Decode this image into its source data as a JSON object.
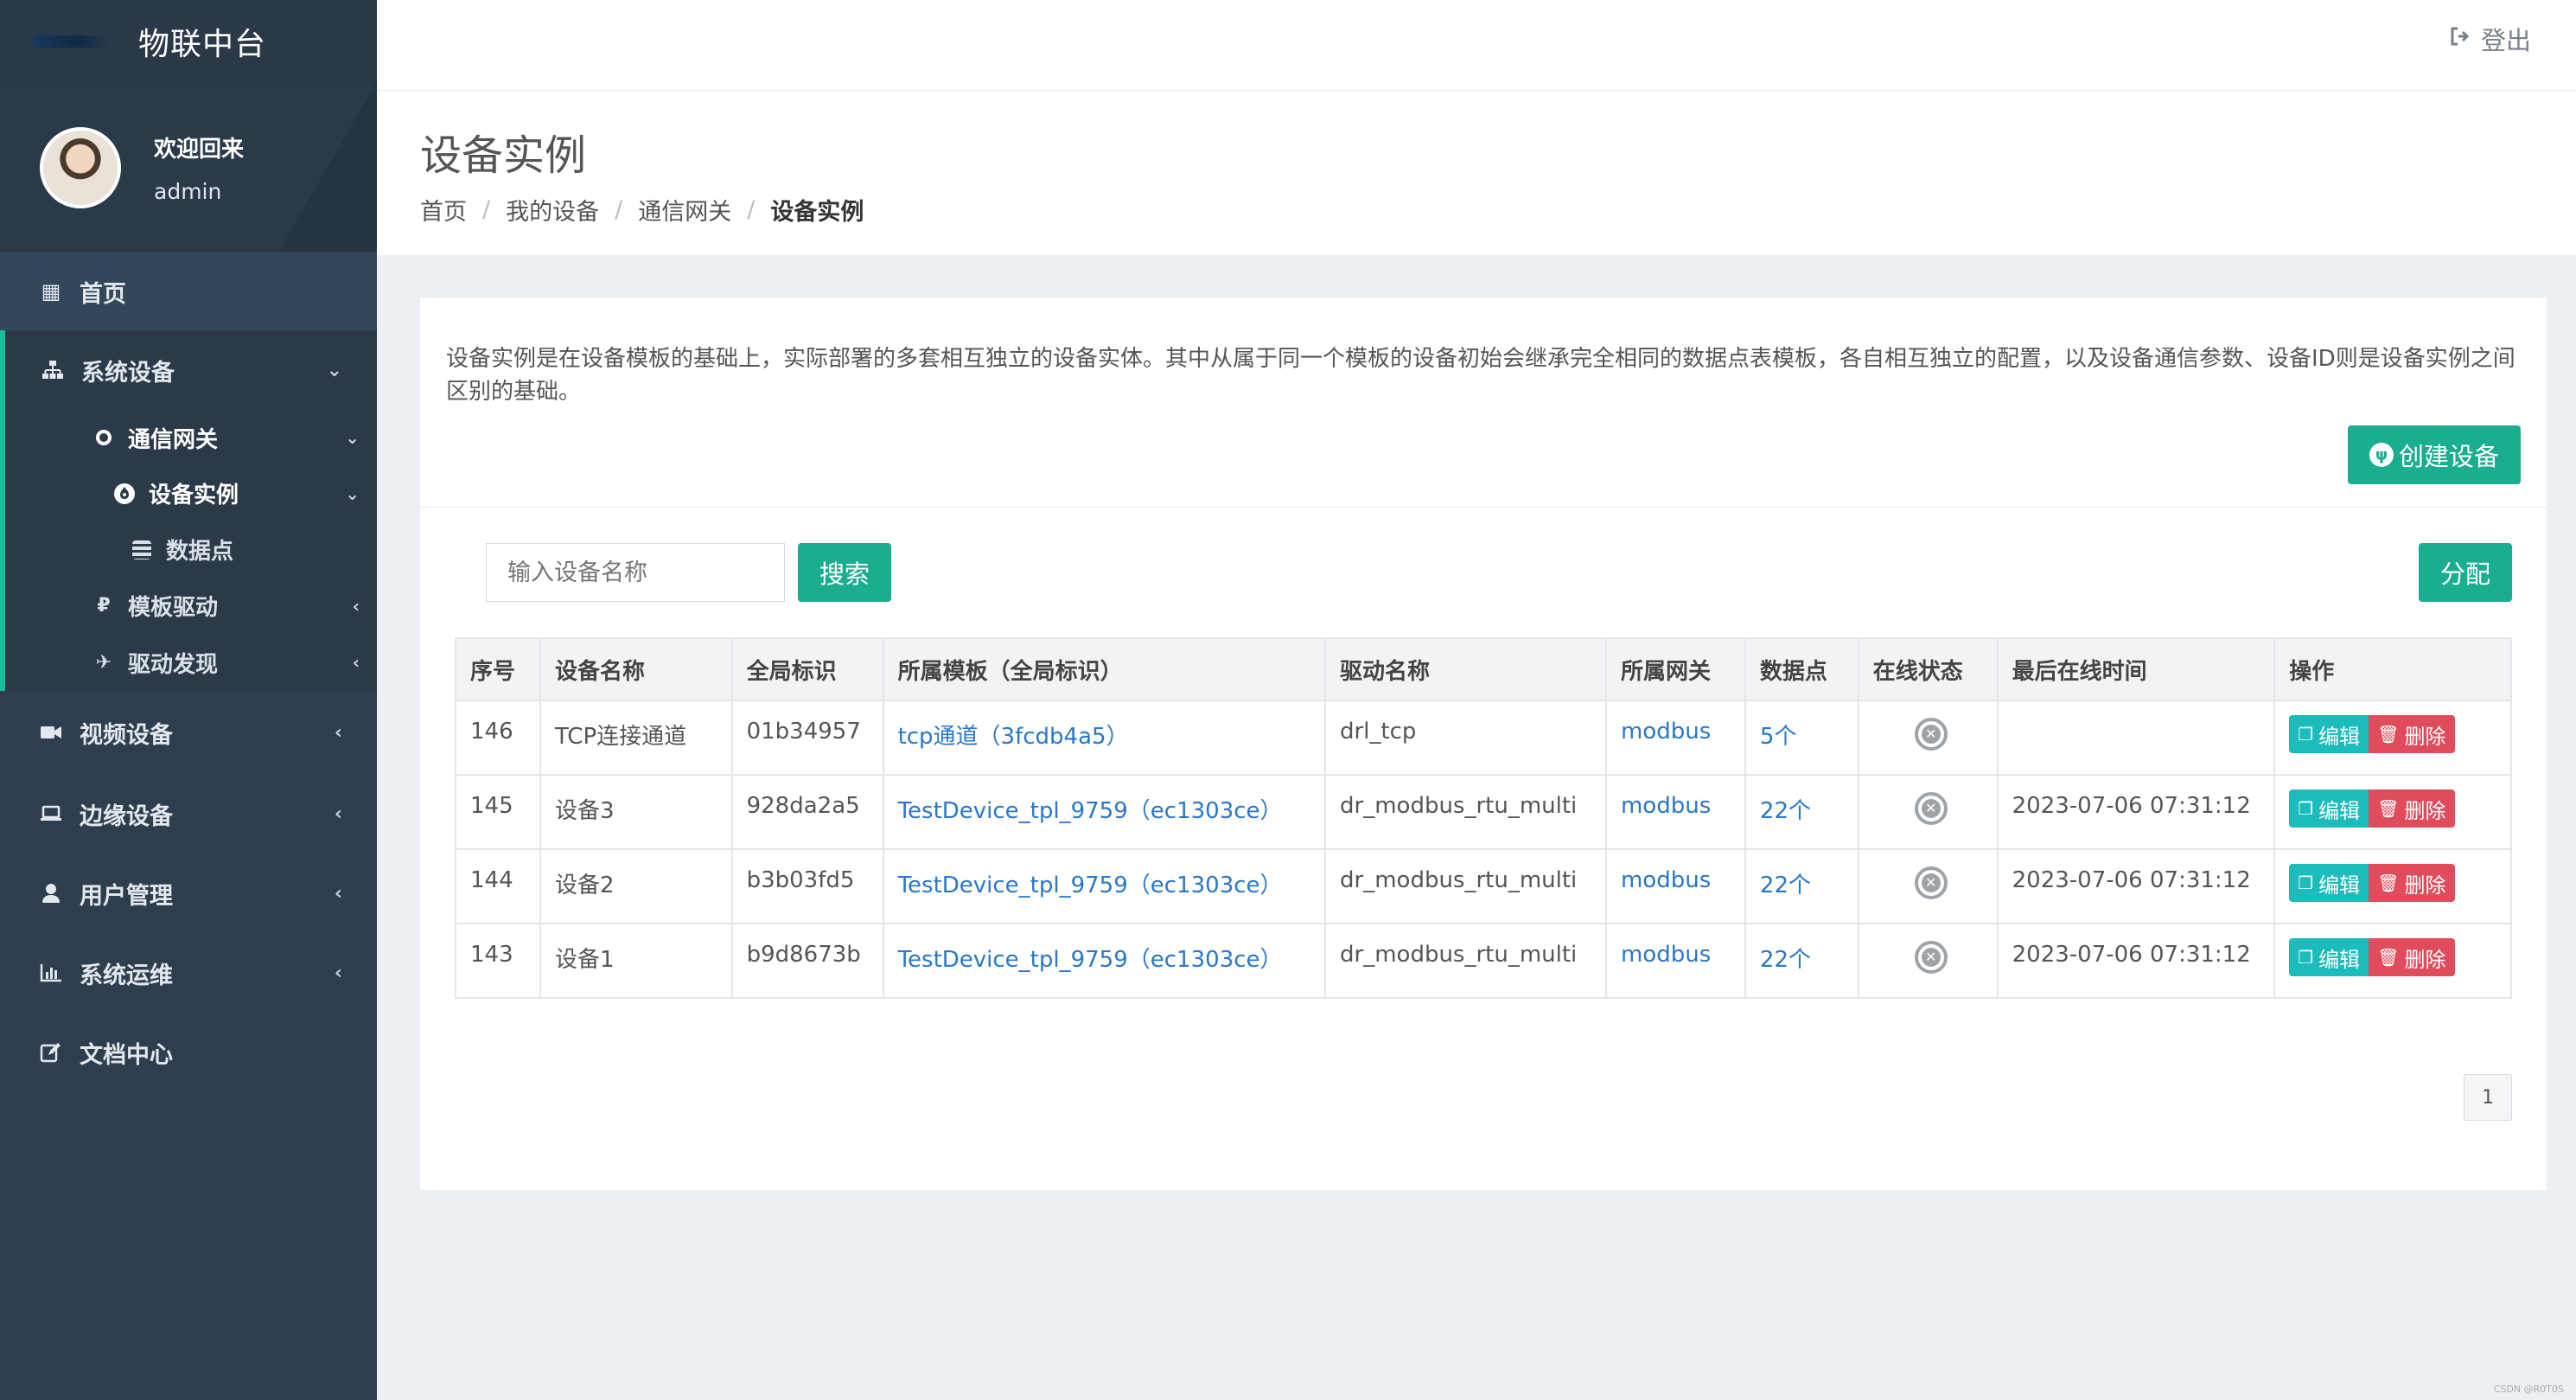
{
  "brand": {
    "title": "物联中台"
  },
  "user": {
    "welcome": "欢迎回来",
    "name": "admin"
  },
  "sidebar": {
    "home": "首页",
    "system_devices": "系统设备",
    "comm_gateway": "通信网关",
    "device_instance": "设备实例",
    "data_points": "数据点",
    "template_driver": "模板驱动",
    "driver_discovery": "驱动发现",
    "video_devices": "视频设备",
    "edge_devices": "边缘设备",
    "user_mgmt": "用户管理",
    "system_ops": "系统运维",
    "doc_center": "文档中心"
  },
  "topbar": {
    "logout": "登出"
  },
  "header": {
    "title": "设备实例",
    "breadcrumb": [
      "首页",
      "我的设备",
      "通信网关",
      "设备实例"
    ]
  },
  "main": {
    "description": "设备实例是在设备模板的基础上，实际部署的多套相互独立的设备实体。其中从属于同一个模板的设备初始会继承完全相同的数据点表模板，各自相互独立的配置，以及设备通信参数、设备ID则是设备实例之间区别的基础。",
    "create_button": "创建设备",
    "search_placeholder": "输入设备名称",
    "search_button": "搜索",
    "assign_button": "分配",
    "table": {
      "headers": [
        "序号",
        "设备名称",
        "全局标识",
        "所属模板（全局标识）",
        "驱动名称",
        "所属网关",
        "数据点",
        "在线状态",
        "最后在线时间",
        "操作"
      ],
      "rows": [
        {
          "id": "146",
          "name": "TCP连接通道",
          "gid": "01b34957",
          "template": "tcp通道（3fcdb4a5）",
          "driver": "drl_tcp",
          "gateway": "modbus",
          "points": "5个",
          "last_online": ""
        },
        {
          "id": "145",
          "name": "设备3",
          "gid": "928da2a5",
          "template": "TestDevice_tpl_9759（ec1303ce）",
          "driver": "dr_modbus_rtu_multi",
          "gateway": "modbus",
          "points": "22个",
          "last_online": "2023-07-06 07:31:12"
        },
        {
          "id": "144",
          "name": "设备2",
          "gid": "b3b03fd5",
          "template": "TestDevice_tpl_9759（ec1303ce）",
          "driver": "dr_modbus_rtu_multi",
          "gateway": "modbus",
          "points": "22个",
          "last_online": "2023-07-06 07:31:12"
        },
        {
          "id": "143",
          "name": "设备1",
          "gid": "b9d8673b",
          "template": "TestDevice_tpl_9759（ec1303ce）",
          "driver": "dr_modbus_rtu_multi",
          "gateway": "modbus",
          "points": "22个",
          "last_online": "2023-07-06 07:31:12"
        }
      ],
      "edit_label": "编辑",
      "delete_label": "删除"
    },
    "pager": {
      "current": "1"
    }
  },
  "watermark": "CSDN @R0T0S"
}
